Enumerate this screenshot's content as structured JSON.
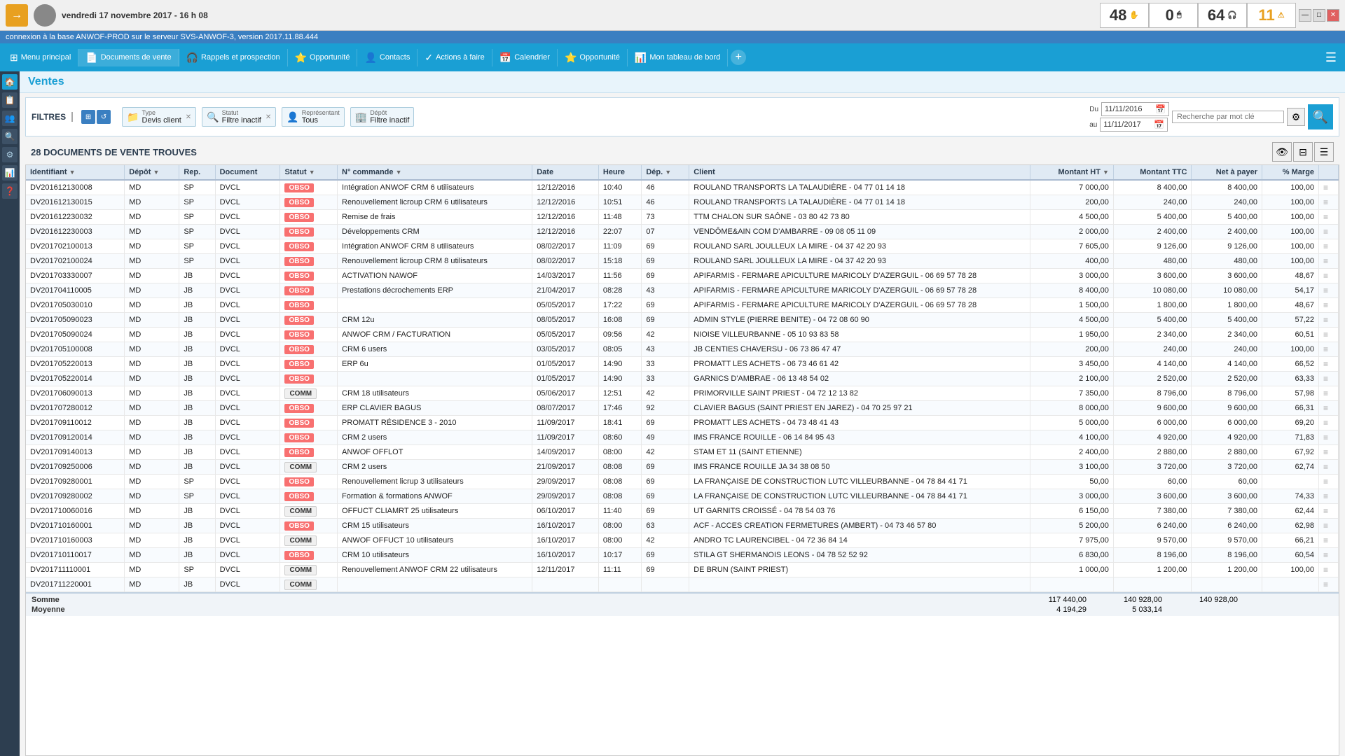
{
  "topbar": {
    "logo": "→",
    "date": "vendredi 17 novembre 2017 - 16 h 08",
    "counters": [
      {
        "value": "48",
        "icon": "✋",
        "class": "c1"
      },
      {
        "value": "0",
        "icon": "🖱",
        "class": "c2"
      },
      {
        "value": "64",
        "icon": "🎧",
        "class": "c3"
      },
      {
        "value": "11",
        "icon": "⚠",
        "class": "c4"
      }
    ],
    "window_controls": [
      "—",
      "□",
      "✕"
    ]
  },
  "statusbar": {
    "text": "connexion à la base ANWOF-PROD sur le serveur SVS-ANWOF-3, version 2017.11.88.444"
  },
  "navbar": {
    "items": [
      {
        "label": "Menu principal",
        "icon": "⊞"
      },
      {
        "label": "Documents de vente",
        "icon": "📄"
      },
      {
        "label": "Rappels et prospection",
        "icon": "🎧"
      },
      {
        "label": "Opportunité",
        "icon": "⭐"
      },
      {
        "label": "Contacts",
        "icon": "👤"
      },
      {
        "label": "Actions à faire",
        "icon": "✓"
      },
      {
        "label": "Calendrier",
        "icon": "📅"
      },
      {
        "label": "Opportunité",
        "icon": "⭐"
      },
      {
        "label": "Mon tableau de bord",
        "icon": "📊"
      }
    ]
  },
  "sidebar": {
    "icons": [
      "🏠",
      "📋",
      "👥",
      "🔍",
      "⚙",
      "📊",
      "❓"
    ]
  },
  "page": {
    "title": "Ventes"
  },
  "filters": {
    "label": "FILTRES",
    "type_label": "Type",
    "type_value": "Devis client",
    "statut_label": "Statut",
    "statut_value": "Filtre inactif",
    "representant_label": "Représentant",
    "representant_value": "Tous",
    "depot_label": "Dépôt",
    "depot_value": "Filtre inactif",
    "date_du_label": "Du",
    "date_au_label": "au",
    "date_du_value": "11/11/2016",
    "date_au_value": "11/11/2017",
    "search_placeholder": "Recherche par mot clé",
    "search_btn_icon": "🔍"
  },
  "results": {
    "count_label": "28 DOCUMENTS DE VENTE TROUVES"
  },
  "table": {
    "columns": [
      "Identifiant",
      "Dépôt",
      "Rep.",
      "Document",
      "Statut",
      "N° commande",
      "Date",
      "Heure",
      "Dép.",
      "Client",
      "Montant HT",
      "Montant TTC",
      "Net à payer",
      "% Marge",
      ""
    ],
    "rows": [
      {
        "id": "DV201612130008",
        "depot": "MD",
        "rep": "SP",
        "doc": "DVCL",
        "statut": "OBSO",
        "commande": "Intégration ANWOF CRM 6 utilisateurs",
        "date": "12/12/2016",
        "heure": "10:40",
        "dep": "46",
        "client": "ROULAND TRANSPORTS LA TALAUDIÈRE - 04 77 01 14 18",
        "ht": "7 000,00",
        "ttc": "8 400,00",
        "net": "8 400,00",
        "marge": "100,00"
      },
      {
        "id": "DV201612130015",
        "depot": "MD",
        "rep": "SP",
        "doc": "DVCL",
        "statut": "OBSO",
        "commande": "Renouvellement licroup CRM 6 utilisateurs",
        "date": "12/12/2016",
        "heure": "10:51",
        "dep": "46",
        "client": "ROULAND TRANSPORTS LA TALAUDIÈRE - 04 77 01 14 18",
        "ht": "200,00",
        "ttc": "240,00",
        "net": "240,00",
        "marge": "100,00"
      },
      {
        "id": "DV201612230032",
        "depot": "MD",
        "rep": "SP",
        "doc": "DVCL",
        "statut": "OBSO",
        "commande": "Remise de frais",
        "date": "12/12/2016",
        "heure": "11:48",
        "dep": "73",
        "client": "TTM CHALON SUR SAÔNE - 03 80 42 73 80",
        "ht": "4 500,00",
        "ttc": "5 400,00",
        "net": "5 400,00",
        "marge": "100,00"
      },
      {
        "id": "DV201612230003",
        "depot": "MD",
        "rep": "SP",
        "doc": "DVCL",
        "statut": "OBSO",
        "commande": "Développements CRM",
        "date": "12/12/2016",
        "heure": "22:07",
        "dep": "07",
        "client": "VENDÔME&AIN COM D'AMBARRE - 09 08 05 11 09",
        "ht": "2 000,00",
        "ttc": "2 400,00",
        "net": "2 400,00",
        "marge": "100,00"
      },
      {
        "id": "DV201702100013",
        "depot": "MD",
        "rep": "SP",
        "doc": "DVCL",
        "statut": "OBSO",
        "commande": "Intégration ANWOF CRM 8 utilisateurs",
        "date": "08/02/2017",
        "heure": "11:09",
        "dep": "69",
        "client": "ROULAND SARL JOULLEUX LA MIRE - 04 37 42 20 93",
        "ht": "7 605,00",
        "ttc": "9 126,00",
        "net": "9 126,00",
        "marge": "100,00"
      },
      {
        "id": "DV201702100024",
        "depot": "MD",
        "rep": "SP",
        "doc": "DVCL",
        "statut": "OBSO",
        "commande": "Renouvellement licroup CRM 8 utilisateurs",
        "date": "08/02/2017",
        "heure": "15:18",
        "dep": "69",
        "client": "ROULAND SARL JOULLEUX LA MIRE - 04 37 42 20 93",
        "ht": "400,00",
        "ttc": "480,00",
        "net": "480,00",
        "marge": "100,00"
      },
      {
        "id": "DV201703330007",
        "depot": "MD",
        "rep": "JB",
        "doc": "DVCL",
        "statut": "OBSO",
        "commande": "ACTIVATION NAWOF",
        "date": "14/03/2017",
        "heure": "11:56",
        "dep": "69",
        "client": "APIFARMIS - FERMARE APICULTURE MARICOLY D'AZERGUIL - 06 69 57 78 28",
        "ht": "3 000,00",
        "ttc": "3 600,00",
        "net": "3 600,00",
        "marge": "48,67"
      },
      {
        "id": "DV201704110005",
        "depot": "MD",
        "rep": "JB",
        "doc": "DVCL",
        "statut": "OBSO",
        "commande": "Prestations décrochements ERP",
        "date": "21/04/2017",
        "heure": "08:28",
        "dep": "43",
        "client": "APIFARMIS - FERMARE APICULTURE MARICOLY D'AZERGUIL - 06 69 57 78 28",
        "ht": "8 400,00",
        "ttc": "10 080,00",
        "net": "10 080,00",
        "marge": "54,17"
      },
      {
        "id": "DV201705030010",
        "depot": "MD",
        "rep": "JB",
        "doc": "DVCL",
        "statut": "OBSO",
        "commande": "",
        "date": "05/05/2017",
        "heure": "17:22",
        "dep": "69",
        "client": "APIFARMIS - FERMARE APICULTURE MARICOLY D'AZERGUIL - 06 69 57 78 28",
        "ht": "1 500,00",
        "ttc": "1 800,00",
        "net": "1 800,00",
        "marge": "48,67"
      },
      {
        "id": "DV201705090023",
        "depot": "MD",
        "rep": "JB",
        "doc": "DVCL",
        "statut": "OBSO",
        "commande": "CRM 12u",
        "date": "08/05/2017",
        "heure": "16:08",
        "dep": "69",
        "client": "ADMIN STYLE (PIERRE BENITE) - 04 72 08 60 90",
        "ht": "4 500,00",
        "ttc": "5 400,00",
        "net": "5 400,00",
        "marge": "57,22"
      },
      {
        "id": "DV201705090024",
        "depot": "MD",
        "rep": "JB",
        "doc": "DVCL",
        "statut": "OBSO",
        "commande": "ANWOF CRM / FACTURATION",
        "date": "05/05/2017",
        "heure": "09:56",
        "dep": "42",
        "client": "NIOISE VILLEURBANNE - 05 10 93 83 58",
        "ht": "1 950,00",
        "ttc": "2 340,00",
        "net": "2 340,00",
        "marge": "60,51"
      },
      {
        "id": "DV201705100008",
        "depot": "MD",
        "rep": "JB",
        "doc": "DVCL",
        "statut": "OBSO",
        "commande": "CRM 6 users",
        "date": "03/05/2017",
        "heure": "08:05",
        "dep": "43",
        "client": "JB CENTIES CHAVERSU - 06 73 86 47 47",
        "ht": "200,00",
        "ttc": "240,00",
        "net": "240,00",
        "marge": "100,00"
      },
      {
        "id": "DV201705220013",
        "depot": "MD",
        "rep": "JB",
        "doc": "DVCL",
        "statut": "OBSO",
        "commande": "ERP 6u",
        "date": "01/05/2017",
        "heure": "14:90",
        "dep": "33",
        "client": "PROMATT LES ACHETS - 06 73 46 61 42",
        "ht": "3 450,00",
        "ttc": "4 140,00",
        "net": "4 140,00",
        "marge": "66,52"
      },
      {
        "id": "DV201705220014",
        "depot": "MD",
        "rep": "JB",
        "doc": "DVCL",
        "statut": "OBSO",
        "commande": "",
        "date": "01/05/2017",
        "heure": "14:90",
        "dep": "33",
        "client": "GARNICS D'AMBRAE - 06 13 48 54 02",
        "ht": "2 100,00",
        "ttc": "2 520,00",
        "net": "2 520,00",
        "marge": "63,33"
      },
      {
        "id": "DV201706090013",
        "depot": "MD",
        "rep": "JB",
        "doc": "DVCL",
        "statut": "COMM",
        "commande": "CRM 18 utilisateurs",
        "date": "05/06/2017",
        "heure": "12:51",
        "dep": "42",
        "client": "PRIMORVILLE SAINT PRIEST - 04 72 12 13 82",
        "ht": "7 350,00",
        "ttc": "8 796,00",
        "net": "8 796,00",
        "marge": "57,98"
      },
      {
        "id": "DV201707280012",
        "depot": "MD",
        "rep": "JB",
        "doc": "DVCL",
        "statut": "OBSO",
        "commande": "ERP CLAVIER BAGUS",
        "date": "08/07/2017",
        "heure": "17:46",
        "dep": "92",
        "client": "CLAVIER BAGUS (SAINT PRIEST EN JAREZ) - 04 70 25 97 21",
        "ht": "8 000,00",
        "ttc": "9 600,00",
        "net": "9 600,00",
        "marge": "66,31"
      },
      {
        "id": "DV201709110012",
        "depot": "MD",
        "rep": "JB",
        "doc": "DVCL",
        "statut": "OBSO",
        "commande": "PROMATT RÉSIDENCE 3 - 2010",
        "date": "11/09/2017",
        "heure": "18:41",
        "dep": "69",
        "client": "PROMATT LES ACHETS - 04 73 48 41 43",
        "ht": "5 000,00",
        "ttc": "6 000,00",
        "net": "6 000,00",
        "marge": "69,20"
      },
      {
        "id": "DV201709120014",
        "depot": "MD",
        "rep": "JB",
        "doc": "DVCL",
        "statut": "OBSO",
        "commande": "CRM 2 users",
        "date": "11/09/2017",
        "heure": "08:60",
        "dep": "49",
        "client": "IMS FRANCE ROUILLE - 06 14 84 95 43",
        "ht": "4 100,00",
        "ttc": "4 920,00",
        "net": "4 920,00",
        "marge": "71,83"
      },
      {
        "id": "DV201709140013",
        "depot": "MD",
        "rep": "JB",
        "doc": "DVCL",
        "statut": "OBSO",
        "commande": "ANWOF OFFLOT",
        "date": "14/09/2017",
        "heure": "08:00",
        "dep": "42",
        "client": "STAM ET 11 (SAINT ETIENNE)",
        "ht": "2 400,00",
        "ttc": "2 880,00",
        "net": "2 880,00",
        "marge": "67,92"
      },
      {
        "id": "DV201709250006",
        "depot": "MD",
        "rep": "JB",
        "doc": "DVCL",
        "statut": "COMM",
        "commande": "CRM 2 users",
        "date": "21/09/2017",
        "heure": "08:08",
        "dep": "69",
        "client": "IMS FRANCE ROUILLE JA 34 38 08 50",
        "ht": "3 100,00",
        "ttc": "3 720,00",
        "net": "3 720,00",
        "marge": "62,74"
      },
      {
        "id": "DV201709280001",
        "depot": "MD",
        "rep": "SP",
        "doc": "DVCL",
        "statut": "OBSO",
        "commande": "Renouvellement licrup 3 utilisateurs",
        "date": "29/09/2017",
        "heure": "08:08",
        "dep": "69",
        "client": "LA FRANÇAISE DE CONSTRUCTION LUTC VILLEURBANNE - 04 78 84 41 71",
        "ht": "50,00",
        "ttc": "60,00",
        "net": "60,00",
        "marge": ""
      },
      {
        "id": "DV201709280002",
        "depot": "MD",
        "rep": "SP",
        "doc": "DVCL",
        "statut": "OBSO",
        "commande": "Formation & formations ANWOF",
        "date": "29/09/2017",
        "heure": "08:08",
        "dep": "69",
        "client": "LA FRANÇAISE DE CONSTRUCTION LUTC VILLEURBANNE - 04 78 84 41 71",
        "ht": "3 000,00",
        "ttc": "3 600,00",
        "net": "3 600,00",
        "marge": "74,33"
      },
      {
        "id": "DV201710060016",
        "depot": "MD",
        "rep": "JB",
        "doc": "DVCL",
        "statut": "COMM",
        "commande": "OFFUCT CLIAMRT 25 utilisateurs",
        "date": "06/10/2017",
        "heure": "11:40",
        "dep": "69",
        "client": "UT GARNITS CROISSÉ - 04 78 54 03 76",
        "ht": "6 150,00",
        "ttc": "7 380,00",
        "net": "7 380,00",
        "marge": "62,44"
      },
      {
        "id": "DV201710160001",
        "depot": "MD",
        "rep": "JB",
        "doc": "DVCL",
        "statut": "OBSO",
        "commande": "CRM 15 utilisateurs",
        "date": "16/10/2017",
        "heure": "08:00",
        "dep": "63",
        "client": "ACF - ACCES CREATION FERMETURES (AMBERT) - 04 73 46 57 80",
        "ht": "5 200,00",
        "ttc": "6 240,00",
        "net": "6 240,00",
        "marge": "62,98"
      },
      {
        "id": "DV201710160003",
        "depot": "MD",
        "rep": "JB",
        "doc": "DVCL",
        "statut": "COMM",
        "commande": "ANWOF OFFUCT 10 utilisateurs",
        "date": "16/10/2017",
        "heure": "08:00",
        "dep": "42",
        "client": "ANDRO TC LAURENCIBEL - 04 72 36 84 14",
        "ht": "7 975,00",
        "ttc": "9 570,00",
        "net": "9 570,00",
        "marge": "66,21"
      },
      {
        "id": "DV201710110017",
        "depot": "MD",
        "rep": "JB",
        "doc": "DVCL",
        "statut": "OBSO",
        "commande": "CRM 10 utilisateurs",
        "date": "16/10/2017",
        "heure": "10:17",
        "dep": "69",
        "client": "STILA GT SHERMANOIS LEONS - 04 78 52 52 92",
        "ht": "6 830,00",
        "ttc": "8 196,00",
        "net": "8 196,00",
        "marge": "60,54"
      },
      {
        "id": "DV201711110001",
        "depot": "MD",
        "rep": "SP",
        "doc": "DVCL",
        "statut": "COMM",
        "commande": "Renouvellement ANWOF CRM 22 utilisateurs",
        "date": "12/11/2017",
        "heure": "11:11",
        "dep": "69",
        "client": "DE BRUN (SAINT PRIEST)",
        "ht": "1 000,00",
        "ttc": "1 200,00",
        "net": "1 200,00",
        "marge": "100,00"
      },
      {
        "id": "DV201711220001",
        "depot": "MD",
        "rep": "JB",
        "doc": "DVCL",
        "statut": "COMM",
        "commande": "",
        "date": "",
        "heure": "",
        "dep": "",
        "client": "",
        "ht": "",
        "ttc": "",
        "net": "",
        "marge": ""
      }
    ],
    "summary": {
      "somme_label": "Somme",
      "moyenne_label": "Moyenne",
      "somme_ht": "117 440,00",
      "somme_ttc": "140 928,00",
      "somme_net": "140 928,00",
      "somme_marge": "",
      "moyenne_ht": "4 194,29",
      "moyenne_ttc": "5 033,14",
      "moyenne_net": "",
      "moyenne_marge": ""
    }
  }
}
